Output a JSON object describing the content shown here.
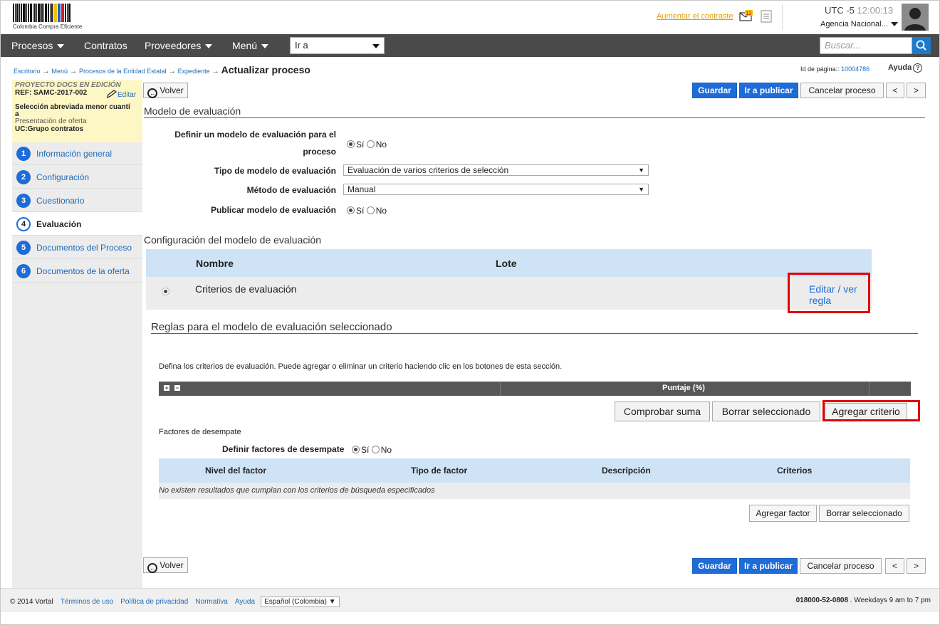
{
  "header": {
    "logo_text": "Colombia Compra Eficiente",
    "contrast_link": "Aumentar el contraste",
    "mail_badge": "12",
    "utc_label": "UTC -5",
    "time": "12:00:13",
    "agency": "Agencia Nacional..."
  },
  "nav": {
    "items": [
      "Procesos",
      "Contratos",
      "Proveedores",
      "Menú"
    ],
    "goto_value": "Ir a",
    "search_placeholder": "Buscar..."
  },
  "breadcrumb": {
    "items": [
      "Escritorio",
      "Menú",
      "Procesos de la Entidad Estatal",
      "Expediente"
    ],
    "current": "Actualizar proceso",
    "page_id_label": "Id de página::",
    "page_id": "10004786",
    "help": "Ayuda"
  },
  "project": {
    "status": "PROYECTO DOCS EN EDICIÓN",
    "ref": "REF: SAMC-2017-002",
    "edit": "Editar",
    "type": "Selección abreviada menor cuantí",
    "type_cont": "a",
    "phase": "Presentación de oferta",
    "uc": "UC:Grupo contratos"
  },
  "steps": [
    {
      "num": "1",
      "label": "Información general"
    },
    {
      "num": "2",
      "label": "Configuración"
    },
    {
      "num": "3",
      "label": "Cuestionario"
    },
    {
      "num": "4",
      "label": "Evaluación"
    },
    {
      "num": "5",
      "label": "Documentos del Proceso"
    },
    {
      "num": "6",
      "label": "Documentos de la oferta"
    }
  ],
  "toolbar": {
    "back": "Volver",
    "save": "Guardar",
    "publish": "Ir a publicar",
    "cancel": "Cancelar proceso",
    "prev": "<",
    "next": ">"
  },
  "model": {
    "title": "Modelo de evaluación",
    "define_label_1": "Definir un modelo de evaluación para el",
    "define_label_2": "proceso",
    "yes": "Sí",
    "no": "No",
    "type_label": "Tipo de modelo de evaluación",
    "type_value": "Evaluación de varios criterios de selección",
    "method_label": "Método de evaluación",
    "method_value": "Manual",
    "publish_label": "Publicar modelo de evaluación"
  },
  "config": {
    "title": "Configuración del modelo de evaluación",
    "col_name": "Nombre",
    "col_lot": "Lote",
    "row_name": "Criterios de evaluación",
    "row_action_1": "Editar / ver",
    "row_action_2": "regla"
  },
  "rules": {
    "title": "Reglas para el modelo de evaluación seleccionado",
    "instructions": "Defina los criterios de evaluación. Puede agregar o eliminar un criterio haciendo clic en los botones de esta sección.",
    "score_col": "Puntaje (%)",
    "check_sum": "Comprobar suma",
    "delete_selected": "Borrar seleccionado",
    "add_criterion": "Agregar criterio"
  },
  "ties": {
    "title": "Factores de desempate",
    "define_label": "Definir factores de desempate",
    "col_level": "Nivel del factor",
    "col_type": "Tipo de factor",
    "col_desc": "Descripción",
    "col_criteria": "Criterios",
    "empty": "No existen resultados que cumplan con los criterios de búsqueda especificados",
    "add_factor": "Agregar factor",
    "delete_selected": "Borrar seleccionado"
  },
  "footer": {
    "copyright": "© 2014 Vortal",
    "links": [
      "Términos de uso",
      "Política de privacidad",
      "Normativa",
      "Ayuda"
    ],
    "language": "Español (Colombia)",
    "phone": "018000-52-0808",
    "hours": ". Weekdays 9 am to 7 pm"
  }
}
